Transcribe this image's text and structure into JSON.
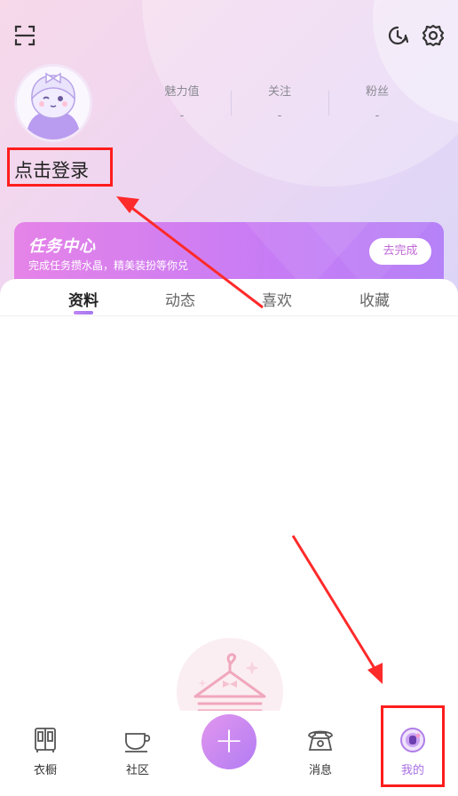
{
  "header": {
    "stats": [
      {
        "label": "魅力值",
        "value": "-"
      },
      {
        "label": "关注",
        "value": "-"
      },
      {
        "label": "粉丝",
        "value": "-"
      }
    ],
    "login_label": "点击登录",
    "icons": {
      "scan": "scan-icon",
      "history": "history-icon",
      "settings": "gear-icon"
    }
  },
  "task_card": {
    "title": "任务中心",
    "subtitle": "完成任务攒水晶，精美装扮等你兑",
    "button_label": "去完成"
  },
  "tabs": {
    "items": [
      {
        "label": "资料",
        "active": true
      },
      {
        "label": "动态",
        "active": false
      },
      {
        "label": "喜欢",
        "active": false
      },
      {
        "label": "收藏",
        "active": false
      }
    ]
  },
  "tabbar": {
    "items": [
      {
        "label": "衣橱",
        "icon": "wardrobe-icon"
      },
      {
        "label": "社区",
        "icon": "teacup-icon"
      },
      {
        "label": "+",
        "icon": "plus-icon"
      },
      {
        "label": "消息",
        "icon": "telephone-icon"
      },
      {
        "label": "我的",
        "icon": "avatar-icon",
        "active": true
      }
    ]
  },
  "colors": {
    "accent": "#a96ee6",
    "annotation_red": "#ff1d1d",
    "task_gradient_start": "#e583e8",
    "task_gradient_end": "#b682f7"
  }
}
